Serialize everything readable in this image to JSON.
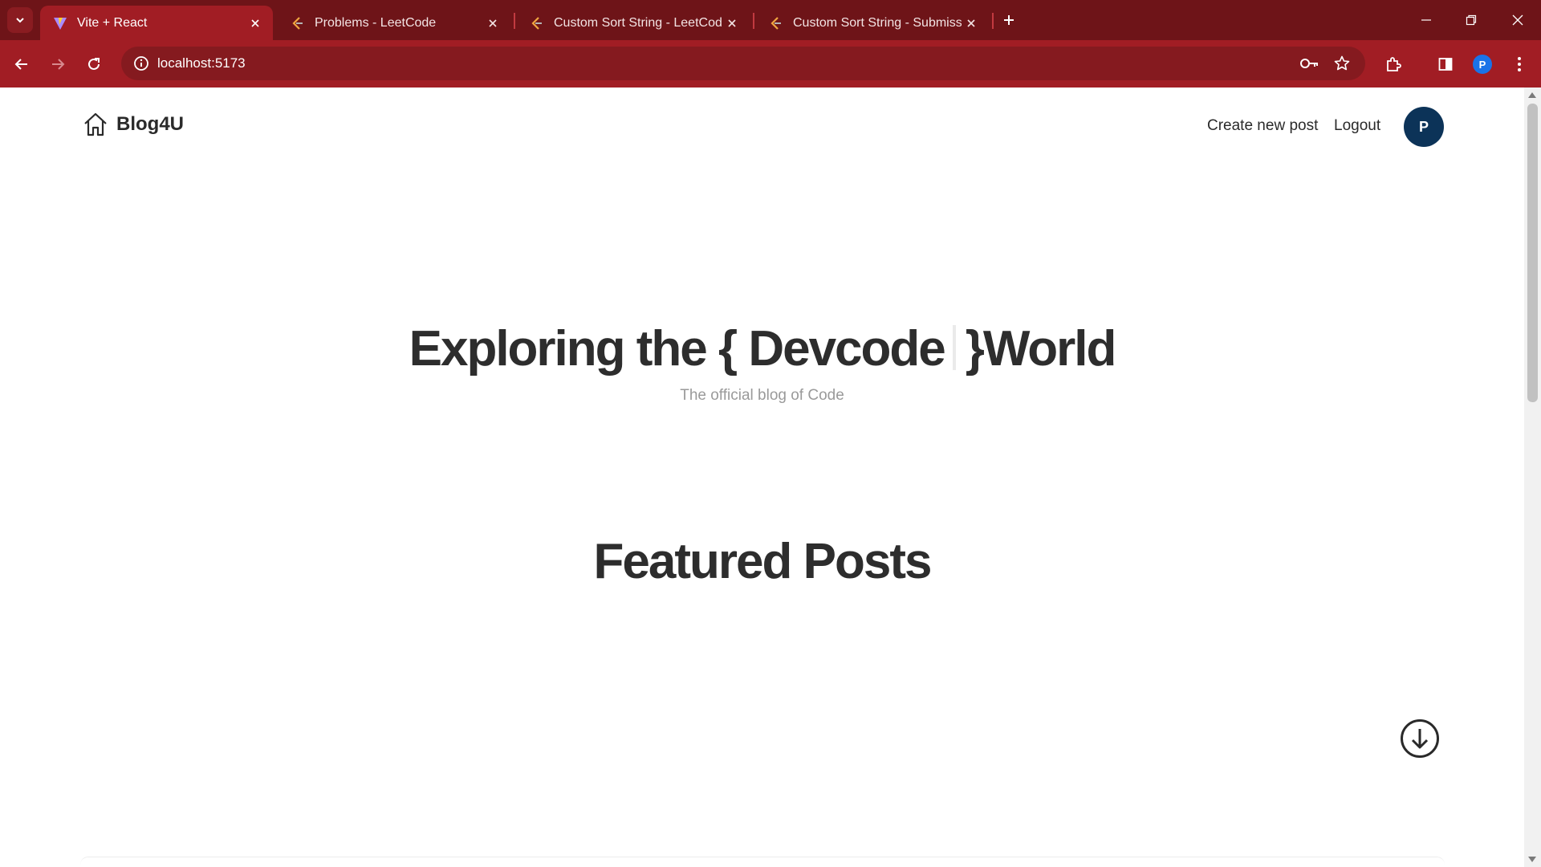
{
  "browser": {
    "tabs": [
      {
        "title": "Vite + React",
        "icon": "vite-icon",
        "active": true
      },
      {
        "title": "Problems - LeetCode",
        "icon": "leetcode-icon",
        "active": false
      },
      {
        "title": "Custom Sort String - LeetCode",
        "icon": "leetcode-icon",
        "active": false
      },
      {
        "title": "Custom Sort String - Submissio",
        "icon": "leetcode-icon",
        "active": false
      }
    ],
    "url": "localhost:5173",
    "profile_initial": "P",
    "colors": {
      "tabbar": "#6e1418",
      "toolbar": "#a11d24",
      "omnibox": "#851a1f"
    }
  },
  "site": {
    "brand": "Blog4U",
    "nav": {
      "create": "Create new post",
      "logout": "Logout"
    },
    "avatar_initial": "P",
    "hero": {
      "title_prefix": "Exploring the { Devcode",
      "title_suffix": "}World",
      "subtitle": "The official blog of Code"
    },
    "featured_heading": "Featured Posts",
    "colors": {
      "avatar": "#0c3358",
      "heading": "#2d2d2d",
      "subtitle": "#9a9a9a"
    }
  }
}
